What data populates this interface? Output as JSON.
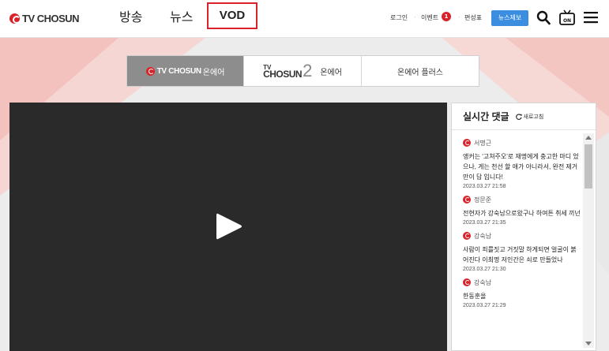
{
  "header": {
    "logo_text": "TV CHOSUN",
    "nav": [
      "방송",
      "뉴스",
      "VOD"
    ],
    "login": "로그인",
    "event": "이벤트",
    "event_badge": "1",
    "schedule": "편성표",
    "news_button": "뉴스제보",
    "tv_icon_label": "ON"
  },
  "tabs": {
    "tab1_brand": "TV CHOSUN",
    "tab1_suffix": "온에어",
    "tab2_tv": "TV",
    "tab2_chosun": "CHOSUN",
    "tab2_num": "2",
    "tab2_suffix": "온에어",
    "tab3": "온에어 플러스"
  },
  "comments_panel": {
    "title": "실시간 댓글",
    "refresh": "새로고침",
    "items": [
      {
        "user": "서명근",
        "text": "앵커는 '고쳐주오'로 재명에게 충고한 마디 었으나, 게는 천선 할 애가 아니라서, 완전 제거 만이 답 입니다!",
        "time": "2023.03.27 21:58"
      },
      {
        "user": "정문준",
        "text": "전현자가 강숙남으로왔구나 하여튼 취세 끼넌",
        "time": "2023.03.27 21:35"
      },
      {
        "user": "강숙남",
        "text": "사람이 죄를짓고 거짓말 하게되면 얼굴이 붉어진다 이최명 저인간은 쇠로 만들었나",
        "time": "2023.03.27 21:30"
      },
      {
        "user": "강숙남",
        "text": "한동훈올",
        "time": "2023.03.27 21:29"
      }
    ]
  },
  "colors": {
    "brand_red": "#d8232a",
    "news_blue": "#3b8de0",
    "active_tab": "#8d8d8d",
    "video_bg": "#2a2a2a"
  }
}
